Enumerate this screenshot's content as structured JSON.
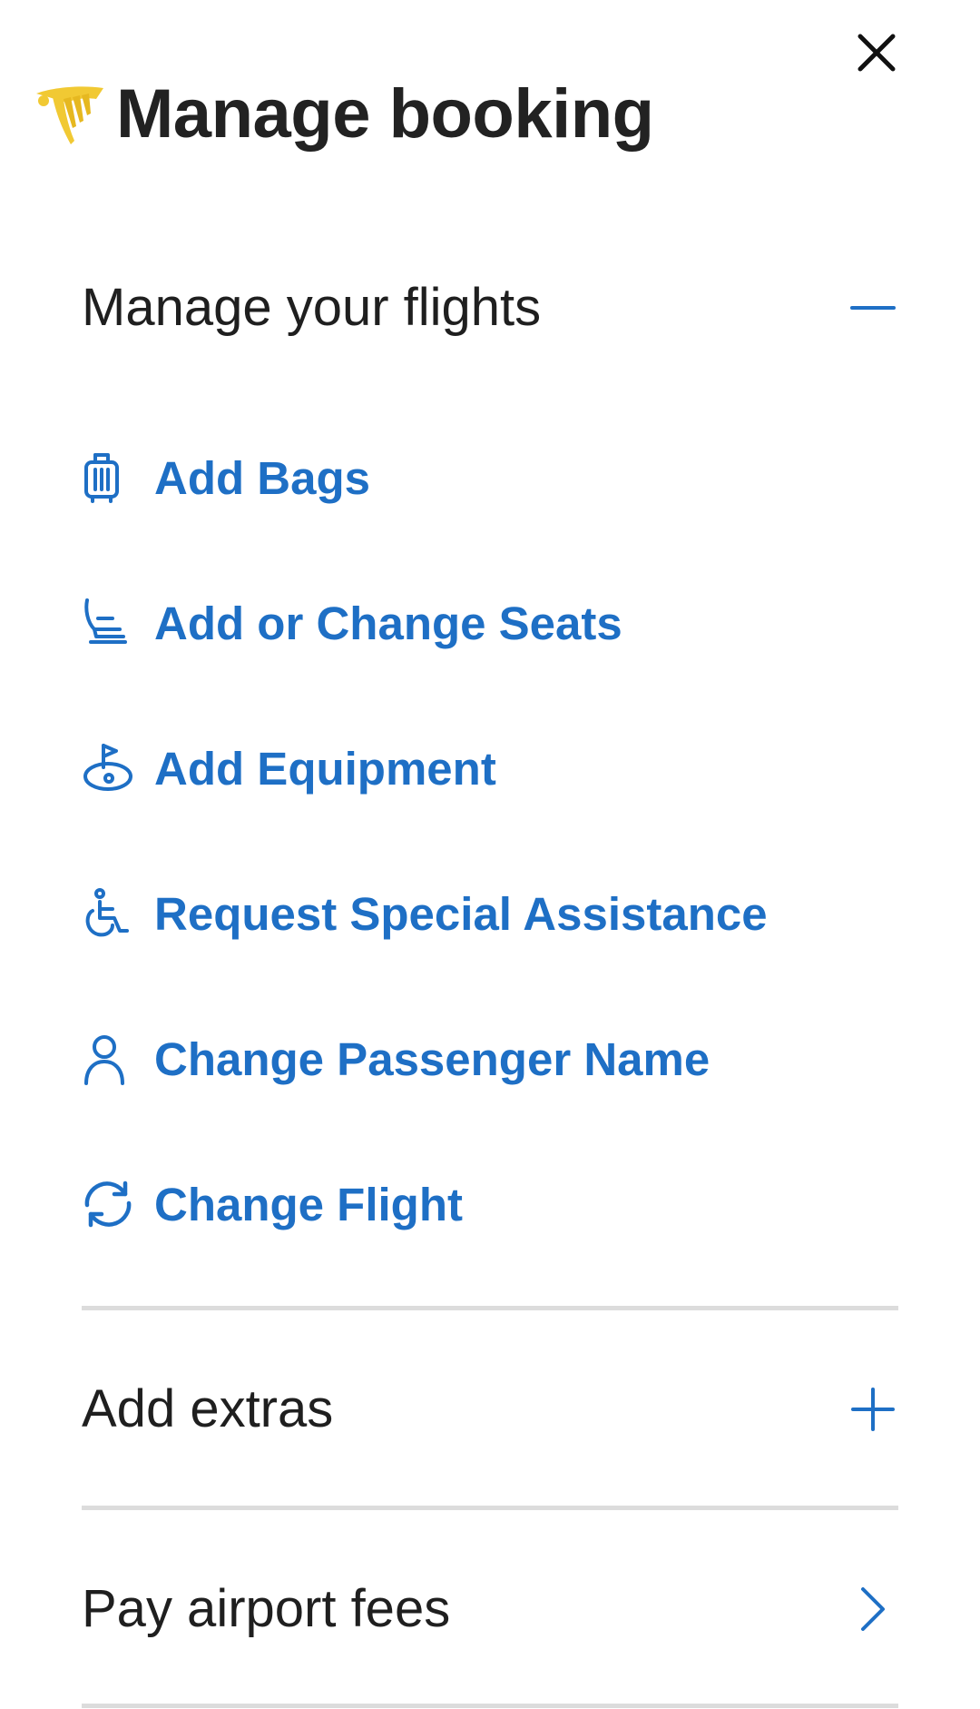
{
  "header": {
    "title": "Manage booking"
  },
  "sections": {
    "manage_flights": {
      "title": "Manage your flights",
      "items": [
        {
          "label": "Add Bags",
          "icon": "luggage-icon"
        },
        {
          "label": "Add or Change Seats",
          "icon": "seat-icon"
        },
        {
          "label": "Add Equipment",
          "icon": "golf-icon"
        },
        {
          "label": "Request Special Assistance",
          "icon": "wheelchair-icon"
        },
        {
          "label": "Change Passenger Name",
          "icon": "person-icon"
        },
        {
          "label": "Change Flight",
          "icon": "refresh-icon"
        }
      ]
    },
    "add_extras": {
      "title": "Add extras"
    },
    "airport_fees": {
      "title": "Pay airport fees"
    }
  },
  "colors": {
    "accent": "#1e6fc5",
    "brand_logo": "#f1c933",
    "divider": "#dcdcdc"
  }
}
